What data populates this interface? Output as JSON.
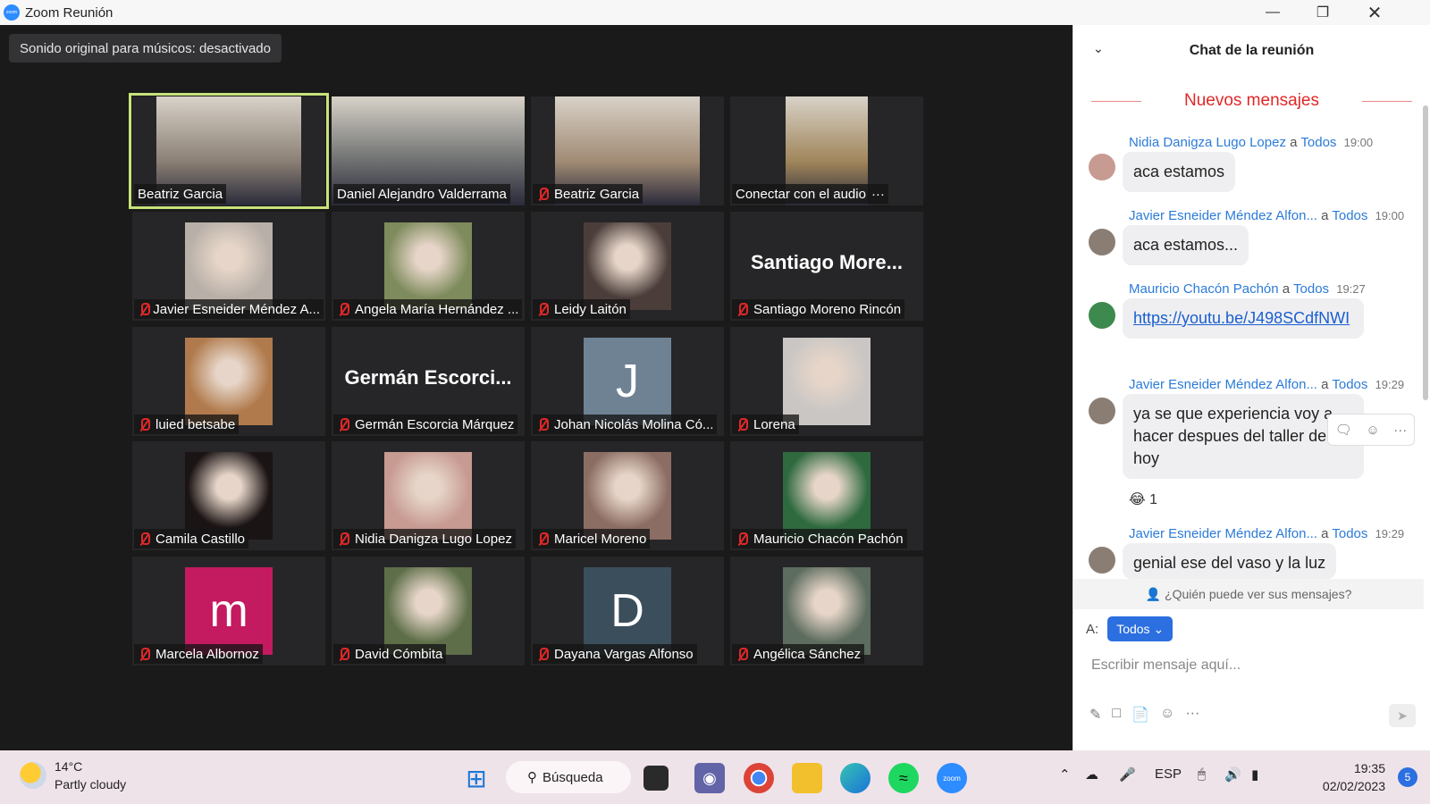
{
  "window": {
    "title": "Zoom Reunión"
  },
  "banner": {
    "original_sound": "Sonido original para músicos: desactivado"
  },
  "tiles": [
    {
      "name": "Beatriz Garcia",
      "kind": "video",
      "active": true,
      "muted": false,
      "color": "#8a7f74"
    },
    {
      "name": "Daniel Alejandro Valderrama",
      "kind": "video",
      "muted": false,
      "color": "#6d6f70"
    },
    {
      "name": "Beatriz Garcia",
      "kind": "video",
      "muted": true,
      "color": "#a08a74"
    },
    {
      "name": "Conectar con el audio",
      "kind": "video",
      "muted": false,
      "more": "···",
      "color": "#a0855a"
    },
    {
      "name": "Javier Esneider Méndez A...",
      "kind": "photo",
      "muted": true,
      "color": "#b8b0a8"
    },
    {
      "name": "Angela María Hernández ...",
      "kind": "photo",
      "muted": true,
      "color": "#7e8b5c"
    },
    {
      "name": "Leidy Laitón",
      "kind": "photo",
      "muted": true,
      "color": "#4b3e3a"
    },
    {
      "name": "Santiago Moreno Rincón",
      "kind": "text",
      "display": "Santiago  More...",
      "muted": true
    },
    {
      "name": "luied betsabe",
      "kind": "photo",
      "muted": true,
      "color": "#b07a4c"
    },
    {
      "name": "Germán Escorcia Márquez",
      "kind": "text",
      "display": "Germán  Escorci...",
      "muted": true
    },
    {
      "name": "Johan Nicolás Molina Có...",
      "kind": "letter",
      "letter": "J",
      "muted": true,
      "color": "#6e8294"
    },
    {
      "name": "Lorena",
      "kind": "photo",
      "muted": true,
      "color": "#c9c6c4"
    },
    {
      "name": "Camila Castillo",
      "kind": "photo",
      "muted": true,
      "color": "#1b1414"
    },
    {
      "name": "Nidia Danigza Lugo Lopez",
      "kind": "photo",
      "muted": true,
      "color": "#c79a92"
    },
    {
      "name": "Maricel Moreno",
      "kind": "photo",
      "muted": true,
      "color": "#8c6d64"
    },
    {
      "name": "Mauricio Chacón Pachón",
      "kind": "photo",
      "muted": true,
      "color": "#2f6a3f"
    },
    {
      "name": "Marcela Albornoz",
      "kind": "letter",
      "letter": "m",
      "muted": true,
      "color": "#c41a5f"
    },
    {
      "name": "David Cómbita",
      "kind": "photo",
      "muted": true,
      "color": "#5d6e48"
    },
    {
      "name": "Dayana Vargas Alfonso",
      "kind": "letter",
      "letter": "D",
      "muted": true,
      "color": "#3b4e5c"
    },
    {
      "name": "Angélica Sánchez",
      "kind": "photo",
      "muted": true,
      "color": "#5c6c5e"
    }
  ],
  "chat": {
    "title": "Chat de la reunión",
    "new_messages": "Nuevos mensajes",
    "messages": [
      {
        "sender": "Nidia Danigza Lugo Lopez",
        "to": "a",
        "recipient": "Todos",
        "time": "19:00",
        "text": "aca estamos",
        "avatar_color": "#c79a92"
      },
      {
        "sender": "Javier Esneider Méndez Alfon...",
        "to": "a",
        "recipient": "Todos",
        "time": "19:00",
        "text": "aca estamos...",
        "avatar_color": "#8a7d74"
      },
      {
        "sender": "Mauricio Chacón Pachón",
        "to": "a",
        "recipient": "Todos",
        "time": "19:27",
        "link": "https://youtu.be/J498SCdfNWI",
        "avatar_color": "#3c8a4e"
      },
      {
        "sender": "Javier Esneider Méndez Alfon...",
        "to": "a",
        "recipient": "Todos",
        "time": "19:29",
        "text": "ya se que experiencia voy a hacer despues del taller de hoy",
        "reaction": "😂",
        "reaction_count": "1",
        "avatar_color": "#8a7d74"
      },
      {
        "sender": "Javier Esneider Méndez Alfon...",
        "to": "a",
        "recipient": "Todos",
        "time": "19:29",
        "text": "genial ese del vaso y la luz",
        "avatar_color": "#8a7d74"
      }
    ],
    "visibility": "¿Quién puede ver sus mensajes?",
    "to_label": "A:",
    "to_value": "Todos",
    "input_placeholder": "Escribir mensaje aquí..."
  },
  "taskbar": {
    "weather_temp": "14°C",
    "weather_desc": "Partly cloudy",
    "search_label": "Búsqueda",
    "language": "ESP",
    "time": "19:35",
    "date": "02/02/2023",
    "notifications": "5"
  }
}
